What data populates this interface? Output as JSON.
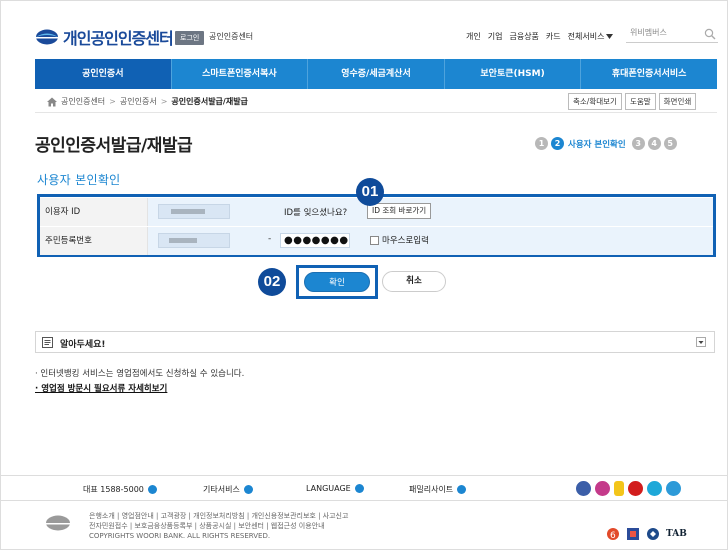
{
  "header": {
    "logo_text": "개인공인인증센터",
    "login_label": "로그인",
    "sub_title": "공인인증센터",
    "top_links": [
      "개인",
      "기업",
      "금융상품",
      "카드",
      "전체서비스"
    ],
    "search_placeholder": "위비멤버스"
  },
  "nav": {
    "items": [
      {
        "label": "공인인증서"
      },
      {
        "label": "스마트폰인증서복사"
      },
      {
        "label": "영수증/세금계산서"
      },
      {
        "label": "보안토큰(HSM)"
      },
      {
        "label": "휴대폰인증서서비스"
      }
    ]
  },
  "breadcrumb": {
    "items": [
      "공인인증센터",
      "공인인증서",
      "공인인증서발급/재발급"
    ],
    "separator": ">"
  },
  "utility": {
    "zoom": "축소/확대보기",
    "help": "도움말",
    "print": "화면인쇄"
  },
  "page": {
    "title": "공인인증서발급/재발급",
    "section_title": "사용자 본인확인"
  },
  "steps": {
    "before": [
      "1"
    ],
    "current_number": "2",
    "current_label": "사용자 본인확인",
    "after": [
      "3",
      "4",
      "5"
    ]
  },
  "form": {
    "id_label": "이용자 ID",
    "forgot_text": "ID를 잊으셨나요?",
    "lookup_button": "ID 조회 바로가기",
    "rrn_label": "주민등록번호",
    "rrn_dash": "-",
    "rrn_masked": "●●●●●●●",
    "mouse_input_label": "마우스로입력"
  },
  "badges": {
    "one": "01",
    "two": "02"
  },
  "buttons": {
    "confirm": "확인",
    "cancel": "취소"
  },
  "notice": {
    "title": "알아두세요!",
    "line1": "· 인터넷뱅킹 서비스는 영업점에서도 신청하실 수 있습니다.",
    "line2": "· 영업점 방문시 필요서류 자세히보기"
  },
  "footer": {
    "phone": "대표 1588-5000",
    "other_services": "기타서비스",
    "language": "LANGUAGE",
    "family_sites": "패밀리사이트",
    "links_line1": "은행소개 | 영업점안내 | 고객광장 | 개인정보처리방침 | 개인신용정보관리보호 | 사고신고",
    "links_line2": "전자민원접수 | 보호금융상품등록부 | 상품공시실 | 보안센터 | 웹접근성 이용안내",
    "copyright": "COPYRIGHTS WOORI BANK. ALL RIGHTS RESERVED.",
    "tab_mark": "TAB"
  },
  "colors": {
    "primary": "#1c86d1",
    "primary_dark": "#1061b4",
    "badge": "#0f4b9a"
  },
  "icons": {
    "home": "home-icon",
    "search": "search-icon",
    "notice": "notice-icon",
    "social": [
      "facebook-icon",
      "instagram-icon",
      "kakaostory-icon",
      "youtube-icon",
      "play-icon",
      "twitter-icon"
    ]
  }
}
